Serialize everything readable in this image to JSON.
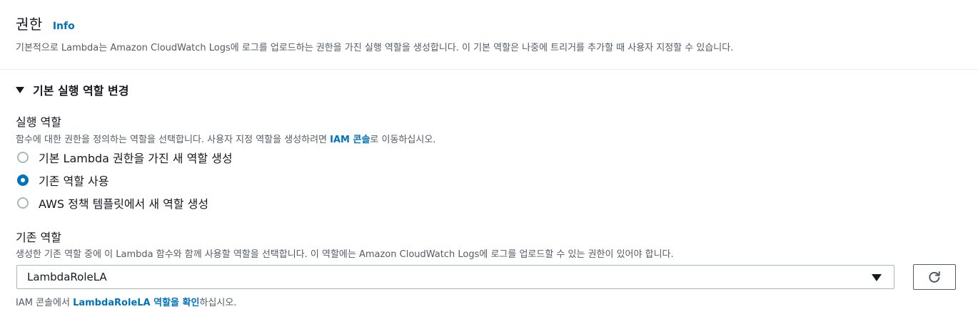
{
  "permissions": {
    "title": "권한",
    "info_link": "Info",
    "description": "기본적으로 Lambda는 Amazon CloudWatch Logs에 로그를 업로드하는 권한을 가진 실행 역할을 생성합니다. 이 기본 역할은 나중에 트리거를 추가할 때 사용자 지정할 수 있습니다."
  },
  "expander": {
    "label": "기본 실행 역할 변경",
    "expanded": true
  },
  "execution_role": {
    "label": "실행 역할",
    "desc_before": "함수에 대한 권한을 정의하는 역할을 선택합니다. 사용자 지정 역할을 생성하려면 ",
    "desc_link": "IAM 콘솔",
    "desc_after": "로 이동하십시오.",
    "options": [
      {
        "label": "기본 Lambda 권한을 가진 새 역할 생성",
        "selected": false
      },
      {
        "label": "기존 역할 사용",
        "selected": true
      },
      {
        "label": "AWS 정책 템플릿에서 새 역할 생성",
        "selected": false
      }
    ]
  },
  "existing_role": {
    "label": "기존 역할",
    "description": "생성한 기존 역할 중에 이 Lambda 함수와 함께 사용할 역할을 선택합니다. 이 역할에는 Amazon CloudWatch Logs에 로그를 업로드할 수 있는 권한이 있어야 합니다.",
    "selected_value": "LambdaRoleLA",
    "refresh_icon": "refresh-icon",
    "note_before": "IAM 콘솔에서 ",
    "note_link": "LambdaRoleLA 역할을 확인",
    "note_after": "하십시오."
  },
  "colors": {
    "link": "#0073bb",
    "text": "#16191f",
    "muted": "#545b64",
    "border": "#aab7b8"
  }
}
